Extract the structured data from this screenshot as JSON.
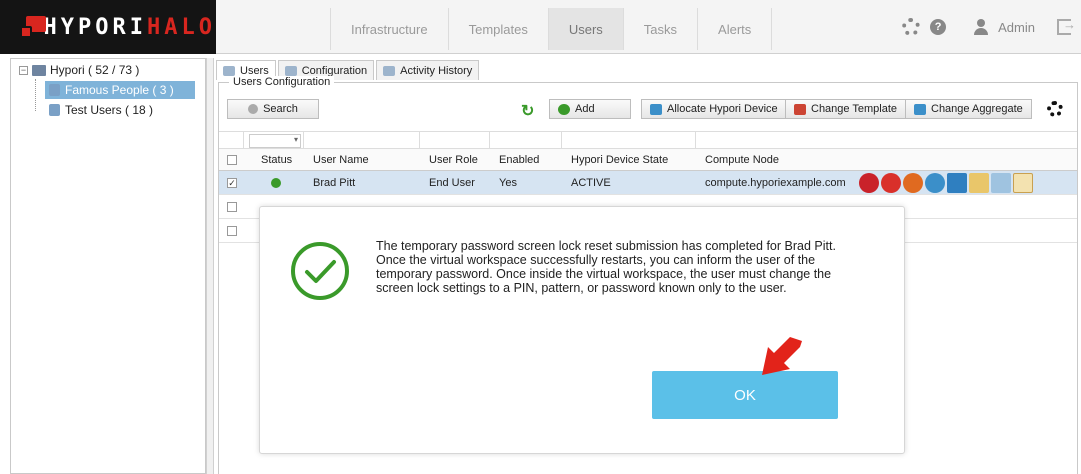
{
  "brand": {
    "name_main": "HYPORI",
    "name_accent": "HALO"
  },
  "nav": {
    "tabs": [
      "Infrastructure",
      "Templates",
      "Users",
      "Tasks",
      "Alerts"
    ],
    "active": "Users"
  },
  "header": {
    "user": "Admin"
  },
  "tree": {
    "root": "Hypori ( 52 / 73 )",
    "children": [
      "Famous People ( 3 )",
      "Test Users ( 18 )"
    ]
  },
  "subtabs": [
    "Users",
    "Configuration",
    "Activity History"
  ],
  "section": {
    "title": "Users Configuration"
  },
  "toolbar": {
    "search": "Search",
    "add": "Add",
    "allocate": "Allocate Hypori Device",
    "change_template": "Change Template",
    "change_aggregate": "Change Aggregate"
  },
  "grid": {
    "columns": [
      "Status",
      "User Name",
      "User Role",
      "Enabled",
      "Hypori Device State",
      "Compute Node"
    ],
    "rows": [
      {
        "status": "green",
        "user_name": "Brad Pitt",
        "user_role": "End User",
        "enabled": "Yes",
        "device_state": "ACTIVE",
        "compute_node": "compute.hyporiexample.com",
        "checked": "✓"
      }
    ]
  },
  "dialog": {
    "message": "The temporary password screen lock reset submission has completed for Brad Pitt. Once the virtual workspace successfully restarts, you can inform the user of the temporary password. Once inside the virtual workspace, the user must change the screen lock settings to a PIN, pattern, or password known only to the user.",
    "ok_label": "OK"
  },
  "colors": {
    "accent_red": "#d8261f",
    "ok_blue": "#5bc0e8",
    "success_green": "#3a9a2a",
    "selection": "#7fb3d9"
  }
}
